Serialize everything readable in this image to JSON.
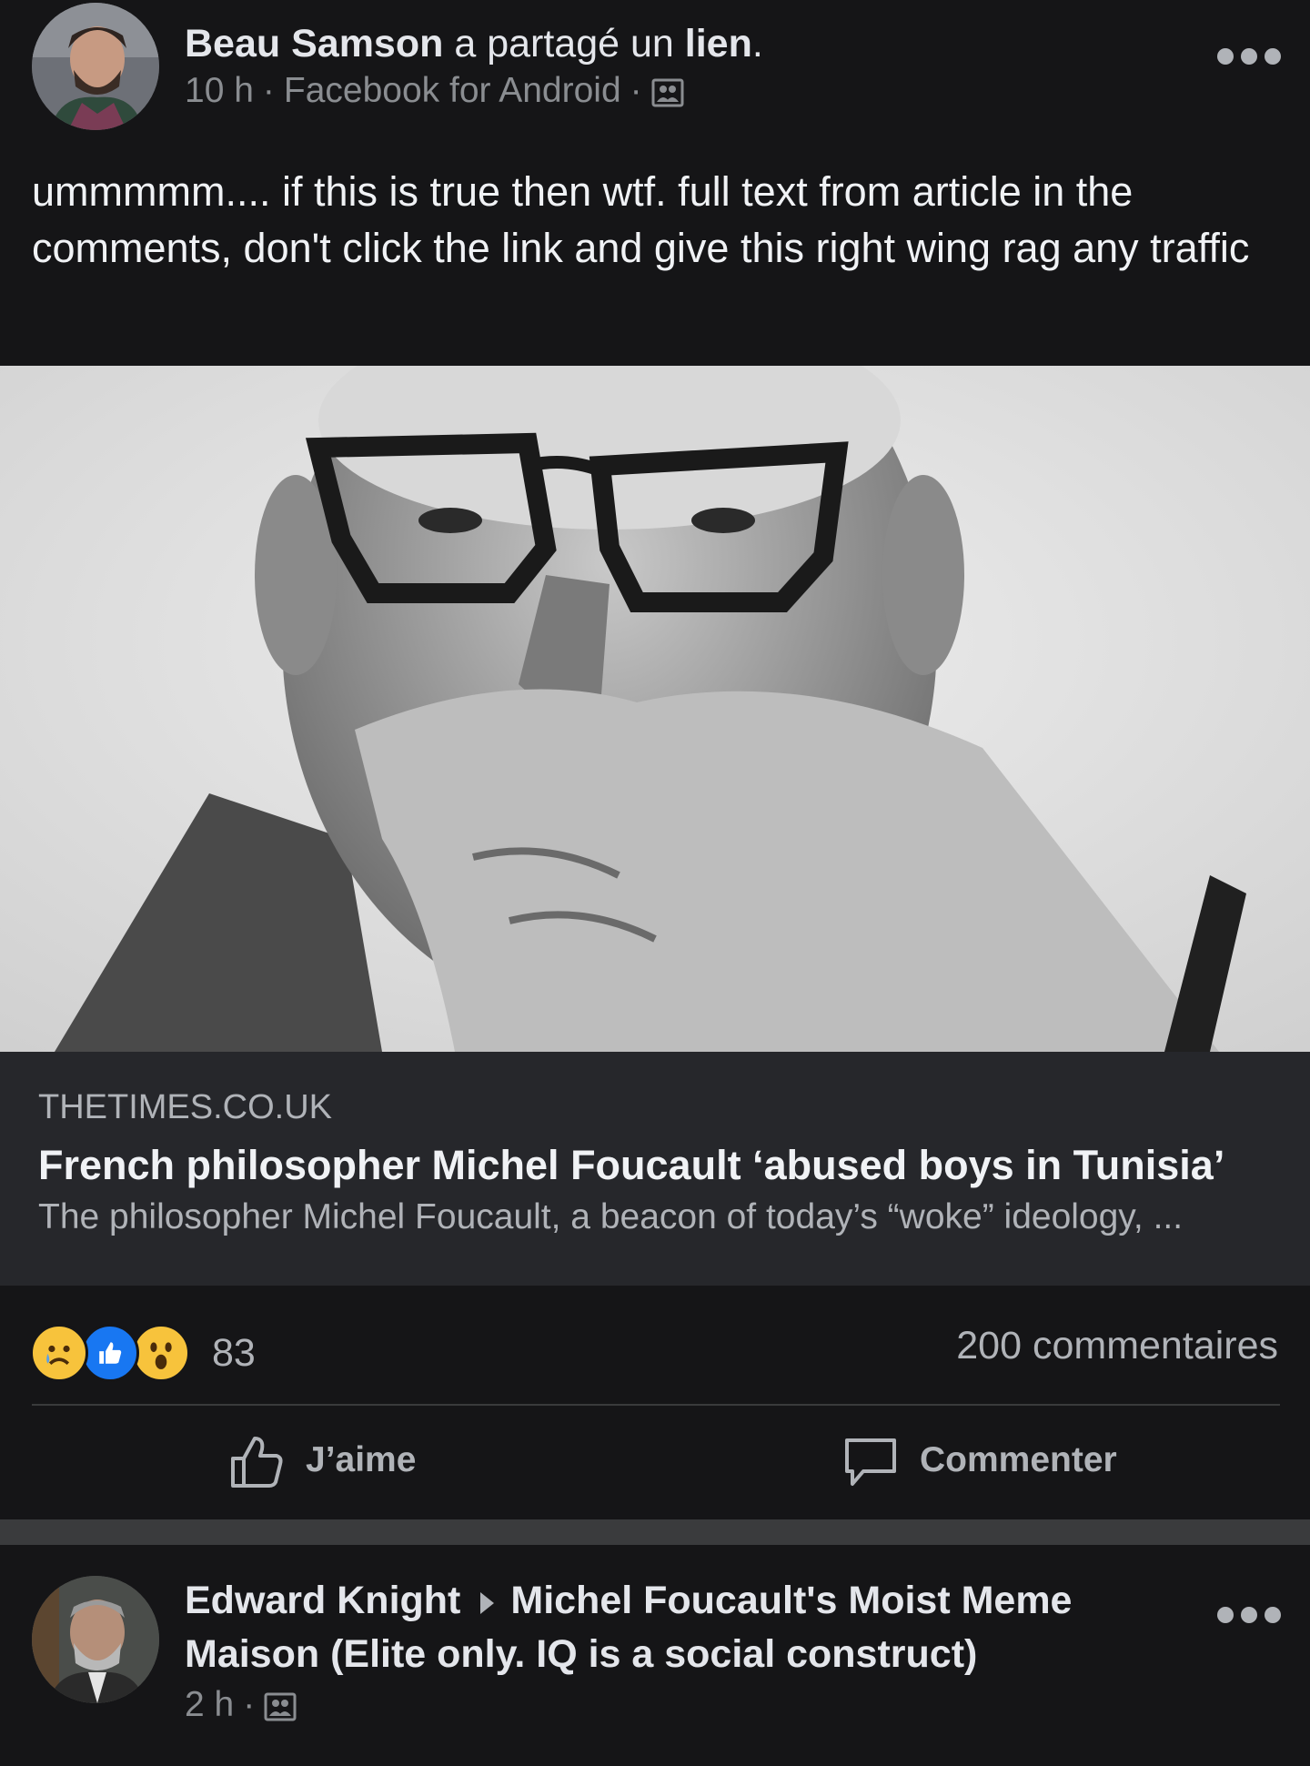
{
  "post": {
    "author": "Beau Samson",
    "action_prefix": "a partagé un",
    "action_object": "lien",
    "action_suffix": ".",
    "time": "10 h",
    "separator": "·",
    "source": "Facebook for Android",
    "audience_icon": "friends-icon",
    "text": "ummmmm.... if this is true then wtf. full text from article in the comments, don't click the link and give this right wing rag any traffic",
    "link": {
      "domain": "THETIMES.CO.UK",
      "title": "French philosopher Michel Foucault ‘abused boys in Tunisia’",
      "description": "The philosopher Michel Foucault, a beacon of today’s “woke” ideology, ..."
    },
    "reactions": {
      "icons": [
        "sad-reaction-icon",
        "like-reaction-icon",
        "wow-reaction-icon"
      ],
      "count": "83"
    },
    "comments_count": "200 commentaires",
    "actions": {
      "like_label": "J’aime",
      "comment_label": "Commenter"
    }
  },
  "next_post": {
    "author": "Edward Knight",
    "group": "Michel Foucault's Moist Meme Maison (Elite only. IQ is a social construct)",
    "time": "2 h",
    "separator": "·",
    "audience_icon": "friends-icon"
  },
  "colors": {
    "background": "#151517",
    "link_card": "#26272b",
    "secondary_text": "#b0b3b8",
    "like_blue": "#1877f2",
    "emoji_yellow": "#f7c33c"
  }
}
